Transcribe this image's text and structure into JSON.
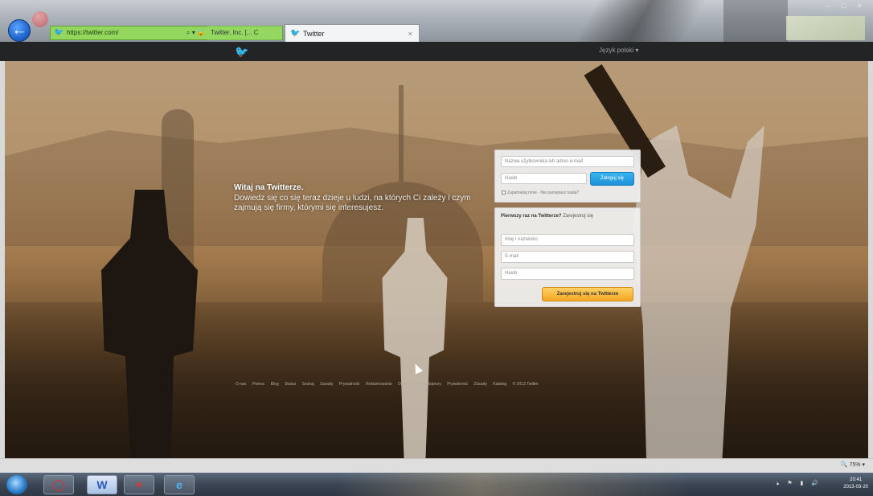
{
  "browser": {
    "address": "https://twitter.com/",
    "address_controls": "⌕ ▾ 🔒",
    "tab_inactive_label": "Twitter, Inc. [...  C",
    "tab_active_label": "Twitter",
    "tab_close": "×",
    "window_controls": "– □ ×"
  },
  "twitter": {
    "bird_icon": "twitter-bird-icon",
    "language_label": "Język polski ▾"
  },
  "hero": {
    "title": "Witaj na Twitterze.",
    "text": "Dowiedz się co się teraz dzieje u ludzi, na których Ci zależy i czym zajmują się firmy, którymi się interesujesz."
  },
  "signin": {
    "username_placeholder": "Nazwa użytkownika lub adres e-mail",
    "password_placeholder": "Hasło",
    "submit_label": "Zaloguj się",
    "remember_label": "Zapamiętaj mnie · Nie pamiętasz hasła?"
  },
  "signup": {
    "heading": "Pierwszy raz na Twitterze?",
    "heading_link": "Zarejestruj się",
    "name_placeholder": "Imię i nazwisko",
    "email_placeholder": "E-mail",
    "password_placeholder": "Hasło",
    "submit_label": "Zarejestruj się na Twitterze"
  },
  "footer_links": [
    "O nas",
    "Pomoc",
    "Blog",
    "Status",
    "Szukaj",
    "Zasady",
    "Prywatność",
    "Reklamowanie",
    "Dla firm",
    "Deweloperzy",
    "Prywatność",
    "Zasady",
    "Katalog",
    "© 2013 Twitter"
  ],
  "status_bar": {
    "zoom": "🔍 75% ▾"
  },
  "taskbar": {
    "word_label": "W",
    "ie_label": "e",
    "tray_icons": "▴ ⚑ ▮ 🔊",
    "time": "20:41",
    "date": "2013-03-20"
  }
}
